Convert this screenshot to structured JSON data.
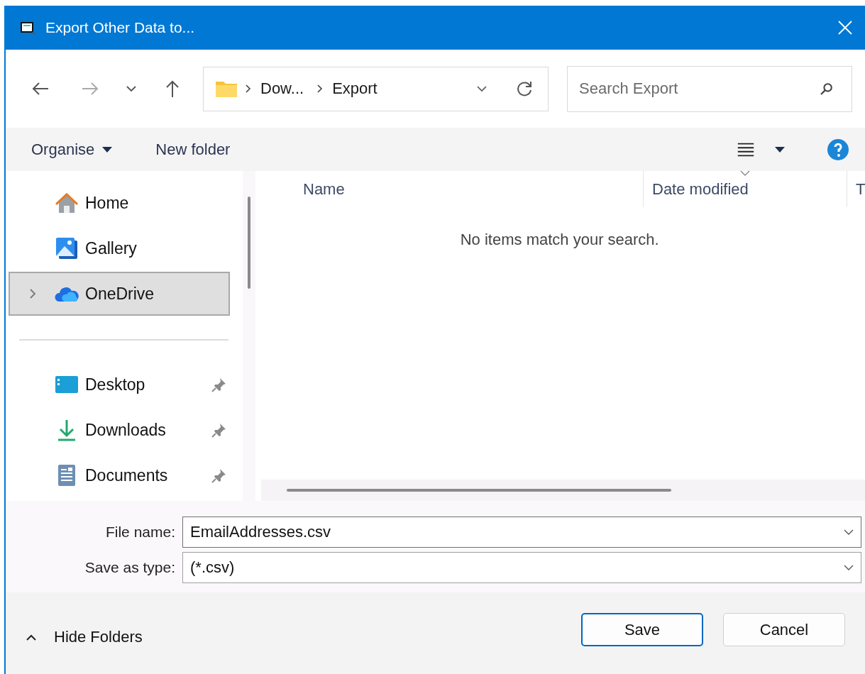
{
  "window": {
    "title": "Export Other Data to..."
  },
  "address_bar": {
    "breadcrumbs": [
      "Dow...",
      "Export"
    ]
  },
  "search": {
    "placeholder": "Search Export"
  },
  "toolbar": {
    "items": [
      {
        "label": "Organise",
        "kind": "menu"
      },
      {
        "label": "New folder",
        "kind": "button"
      }
    ]
  },
  "sidebar": {
    "sections": [
      [
        {
          "label": "Home",
          "kind": "home",
          "selected": false,
          "pinned": false,
          "expandable": false
        },
        {
          "label": "Gallery",
          "kind": "gallery",
          "selected": false,
          "pinned": false,
          "expandable": false
        },
        {
          "label": "OneDrive",
          "kind": "cloud",
          "selected": true,
          "pinned": false,
          "expandable": true
        }
      ],
      [
        {
          "label": "Desktop",
          "kind": "desktop",
          "selected": false,
          "pinned": true,
          "expandable": false
        },
        {
          "label": "Downloads",
          "kind": "downloads",
          "selected": false,
          "pinned": true,
          "expandable": false
        },
        {
          "label": "Documents",
          "kind": "documents",
          "selected": false,
          "pinned": true,
          "expandable": false
        }
      ]
    ]
  },
  "file_list": {
    "columns": [
      {
        "label": "Name",
        "sorted": false
      },
      {
        "label": "Date modified",
        "sorted": true
      },
      {
        "label": "T",
        "sorted": false
      }
    ],
    "empty_message": "No items match your search."
  },
  "form": {
    "file_name": {
      "label": "File name:",
      "value": "EmailAddresses.csv"
    },
    "save_as_type": {
      "label": "Save as type:",
      "value": "(*.csv)"
    }
  },
  "footer": {
    "hide_folders": "Hide Folders",
    "buttons": [
      {
        "label": "Save",
        "default": true
      },
      {
        "label": "Cancel",
        "default": false
      }
    ]
  }
}
